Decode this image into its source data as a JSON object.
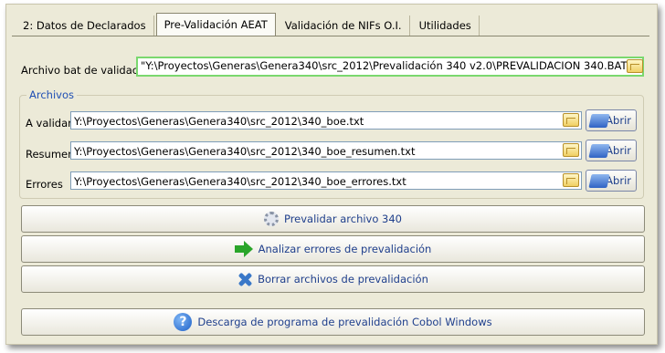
{
  "tabs": [
    {
      "label": "2: Datos de Declarados"
    },
    {
      "label": "Pre-Validación AEAT"
    },
    {
      "label": "Validación de NIFs O.I."
    },
    {
      "label": "Utilidades"
    }
  ],
  "bat": {
    "label": "Archivo bat de validación",
    "value": "\"Y:\\Proyectos\\Generas\\Genera340\\src_2012\\Prevalidación 340 v2.0\\PREVALIDACION 340.BAT\""
  },
  "archivos": {
    "title": "Archivos",
    "rows": [
      {
        "label": "A validar",
        "value": "Y:\\Proyectos\\Generas\\Genera340\\src_2012\\340_boe.txt",
        "open_label": "Abrir"
      },
      {
        "label": "Resumen",
        "value": "Y:\\Proyectos\\Generas\\Genera340\\src_2012\\340_boe_resumen.txt",
        "open_label": "Abrir"
      },
      {
        "label": "Errores",
        "value": "Y:\\Proyectos\\Generas\\Genera340\\src_2012\\340_boe_errores.txt",
        "open_label": "Abrir"
      }
    ]
  },
  "actions": {
    "prevalidar": "Prevalidar archivo 340",
    "analizar": "Analizar errores de prevalidación",
    "borrar": "Borrar archivos de prevalidación",
    "descarga": "Descarga de programa de prevalidación Cobol Windows"
  },
  "icons": {
    "prevalidar": "gear-icon",
    "analizar": "green-arrow-icon",
    "borrar": "blue-x-icon",
    "descarga": "help-icon",
    "browse": "folder-icon",
    "open": "open-folder-icon"
  }
}
